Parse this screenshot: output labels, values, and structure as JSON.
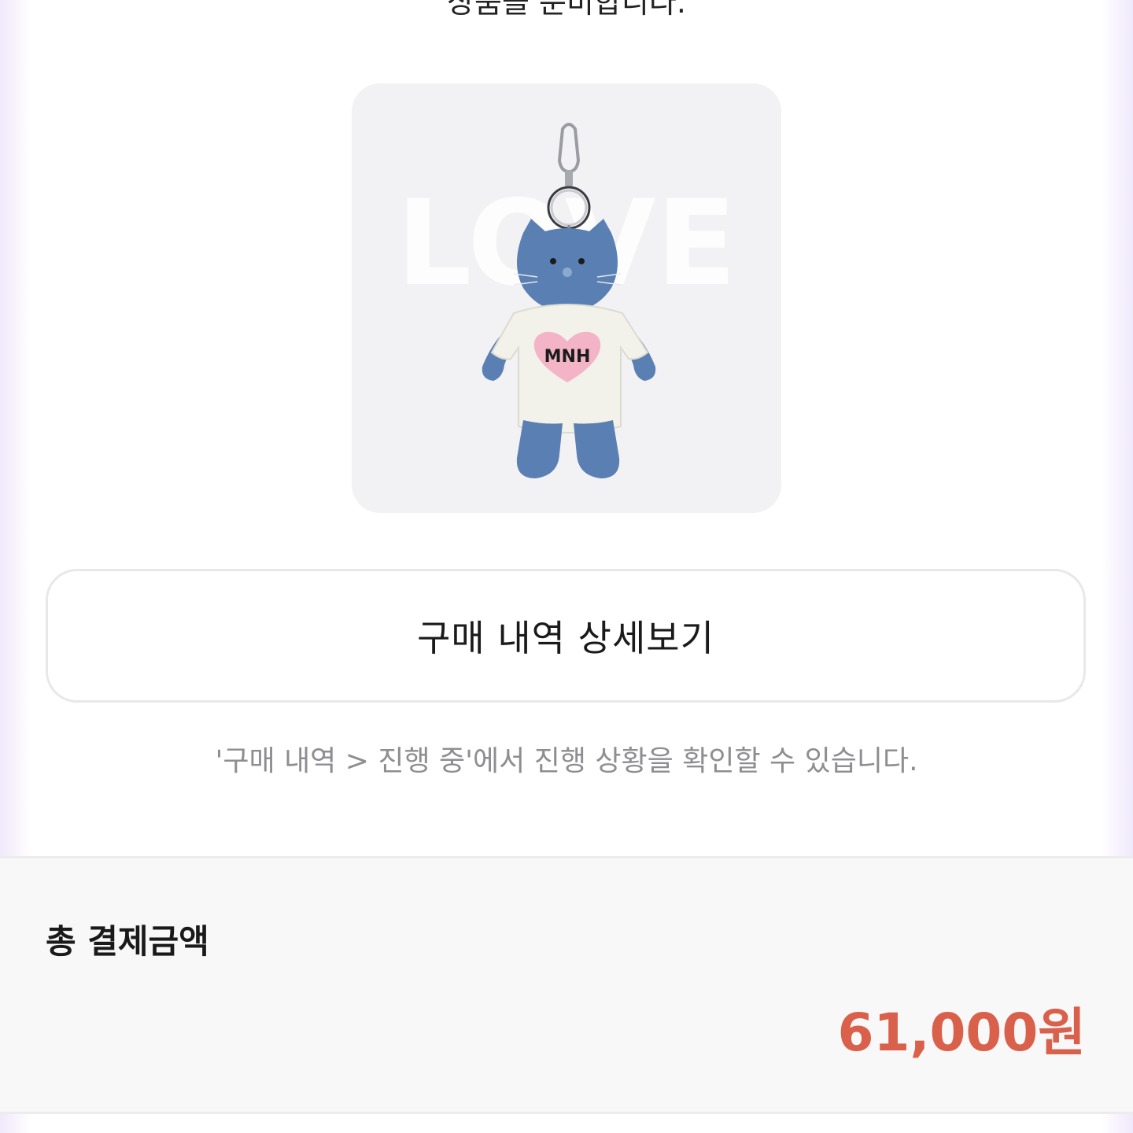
{
  "header": {
    "partial_text": "상품을 준비합니다."
  },
  "product": {
    "image_alt": "product-keyring-plush",
    "sweater_text": "MNH",
    "watermark_text": "LOVE"
  },
  "actions": {
    "detail_button_label": "구매 내역 상세보기"
  },
  "hint": {
    "text": "'구매 내역 > 진행 중'에서 진행 상황을 확인할 수 있습니다."
  },
  "summary": {
    "total_label": "총 결제금액",
    "total_amount": "61,000원"
  },
  "colors": {
    "accent_price": "#d9604a",
    "background_tint": "#efe9fb"
  }
}
